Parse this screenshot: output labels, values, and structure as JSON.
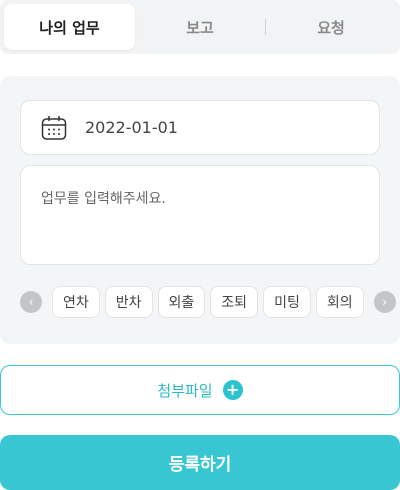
{
  "tabs": [
    {
      "label": "나의 업무",
      "active": true
    },
    {
      "label": "보고",
      "active": false
    },
    {
      "label": "요청",
      "active": false
    }
  ],
  "form": {
    "date": "2022-01-01",
    "task_placeholder": "업무를 입력해주세요.",
    "chips": [
      "연차",
      "반차",
      "외출",
      "조퇴",
      "미팅",
      "회의"
    ],
    "prev_arrow": "‹",
    "next_arrow": "›"
  },
  "attach": {
    "label": "첨부파일",
    "icon": "+"
  },
  "submit": {
    "label": "등록하기"
  },
  "colors": {
    "accent": "#38c6d2",
    "card_bg": "#f4f5f7"
  }
}
